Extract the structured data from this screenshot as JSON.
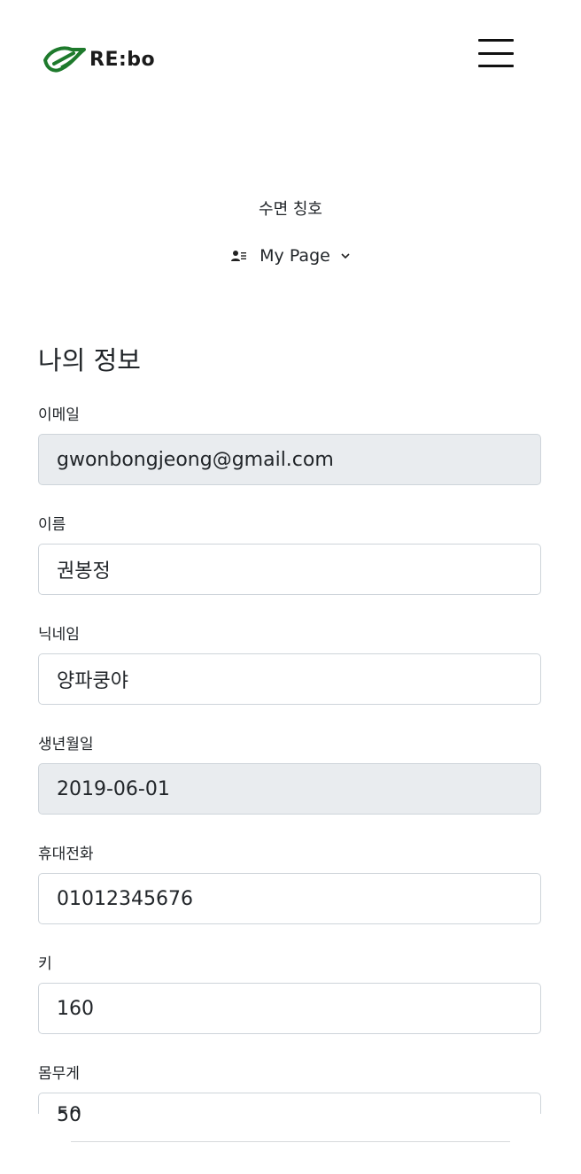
{
  "header": {
    "logo_text": "RE:bo",
    "menu_icon": "hamburger-icon"
  },
  "nav": {
    "sleep_title": "수면 칭호",
    "mypage_label": "My Page",
    "mypage_icon": "user-card-icon",
    "chevron_icon": "chevron-down-icon"
  },
  "section": {
    "title": "나의 정보"
  },
  "fields": {
    "email": {
      "label": "이메일",
      "value": "gwonbongjeong@gmail.com"
    },
    "name": {
      "label": "이름",
      "value": "권봉정"
    },
    "nickname": {
      "label": "닉네임",
      "value": "양파쿵야"
    },
    "birth": {
      "label": "생년월일",
      "value": "2019-06-01"
    },
    "phone": {
      "label": "휴대전화",
      "value": "01012345676"
    },
    "height": {
      "label": "키",
      "value": "160"
    },
    "weight": {
      "label": "몸무게",
      "value": "50"
    }
  },
  "colors": {
    "logo_green": "#1e7a2c",
    "readonly_bg": "#e9ecef",
    "border": "#ced4da"
  }
}
